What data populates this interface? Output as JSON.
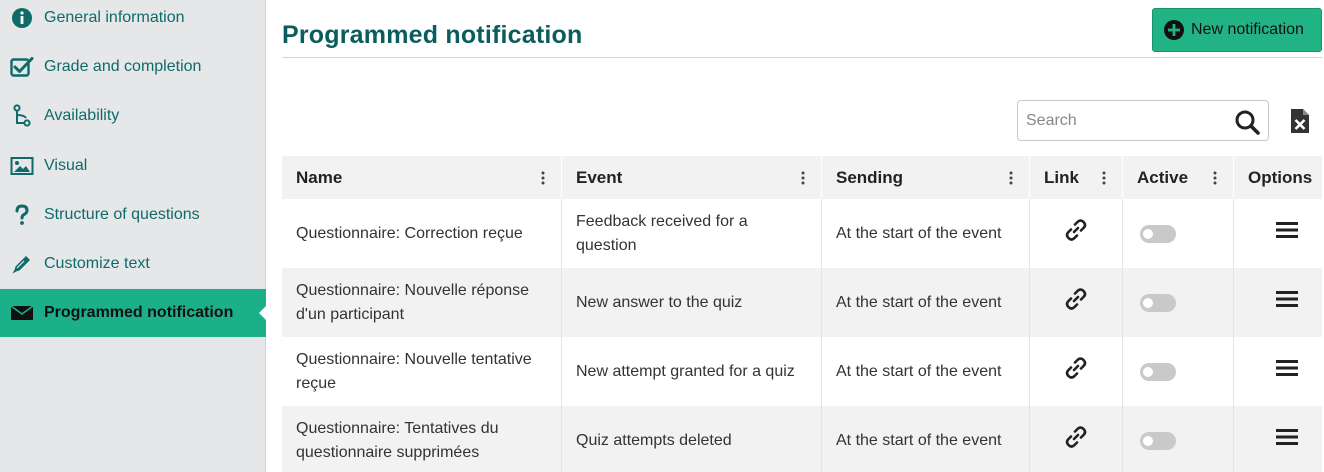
{
  "sidebar": {
    "items": [
      {
        "label": "General information",
        "icon": "info-circle-icon"
      },
      {
        "label": "Grade and completion",
        "icon": "checkbox-checked-icon"
      },
      {
        "label": "Availability",
        "icon": "branch-icon"
      },
      {
        "label": "Visual",
        "icon": "image-icon"
      },
      {
        "label": "Structure of questions",
        "icon": "question-mark-icon"
      },
      {
        "label": "Customize text",
        "icon": "pencil-icon"
      },
      {
        "label": "Programmed notification",
        "icon": "envelope-icon",
        "active": true
      }
    ]
  },
  "header": {
    "title": "Programmed notification",
    "new_button_label": "New notification"
  },
  "search": {
    "placeholder": "Search",
    "value": ""
  },
  "table": {
    "columns": [
      "Name",
      "Event",
      "Sending",
      "Link",
      "Active",
      "Options"
    ],
    "rows": [
      {
        "name": "Questionnaire: Correction reçue",
        "event": "Feedback received for a question",
        "sending": "At the start of the event",
        "active": false
      },
      {
        "name": "Questionnaire: Nouvelle réponse d'un participant",
        "event": "New answer to the quiz",
        "sending": "At the start of the event",
        "active": false
      },
      {
        "name": "Questionnaire: Nouvelle tentative reçue",
        "event": "New attempt granted for a quiz",
        "sending": "At the start of the event",
        "active": false
      },
      {
        "name": "Questionnaire: Tentatives du questionnaire supprimées",
        "event": "Quiz attempts deleted",
        "sending": "At the start of the event",
        "active": false
      }
    ]
  },
  "colors": {
    "accent": "#1cb08a",
    "title": "#0b5c5c",
    "sidebar_text": "#0f6a6a"
  }
}
